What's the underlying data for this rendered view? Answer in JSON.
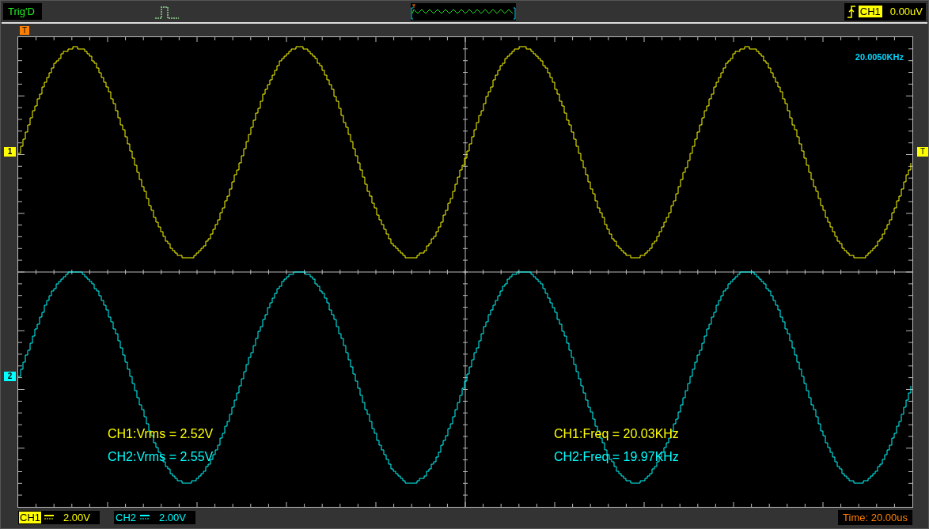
{
  "top_bar": {
    "trigger_status": "Trig'D",
    "trigger": {
      "channel": "CH1",
      "level": "0.00uV"
    }
  },
  "screen": {
    "trigger_position_marker": "T",
    "trigger_level_marker": "T",
    "frequency_readout": "20.0050KHz",
    "channel_markers": [
      {
        "label": "1",
        "color": "#ffff00"
      },
      {
        "label": "2",
        "color": "#00ffff"
      }
    ],
    "measurement_groups": [
      {
        "items": [
          {
            "text": "CH1:Vrms = 2.52V",
            "color": "#ffff00"
          },
          {
            "text": "CH2:Vrms = 2.55V",
            "color": "#00ffff"
          }
        ]
      },
      {
        "items": [
          {
            "text": "CH1:Freq = 20.03KHz",
            "color": "#ffff00"
          },
          {
            "text": "CH2:Freq = 19.97KHz",
            "color": "#00ffff"
          }
        ]
      }
    ]
  },
  "bottom_bar": {
    "channels": [
      {
        "name": "CH1",
        "scale": "2.00V",
        "color": "#ffff00",
        "selected": true
      },
      {
        "name": "CH2",
        "scale": "2.00V",
        "color": "#00ffff",
        "selected": false
      }
    ],
    "timebase": "Time: 20.00us"
  }
}
